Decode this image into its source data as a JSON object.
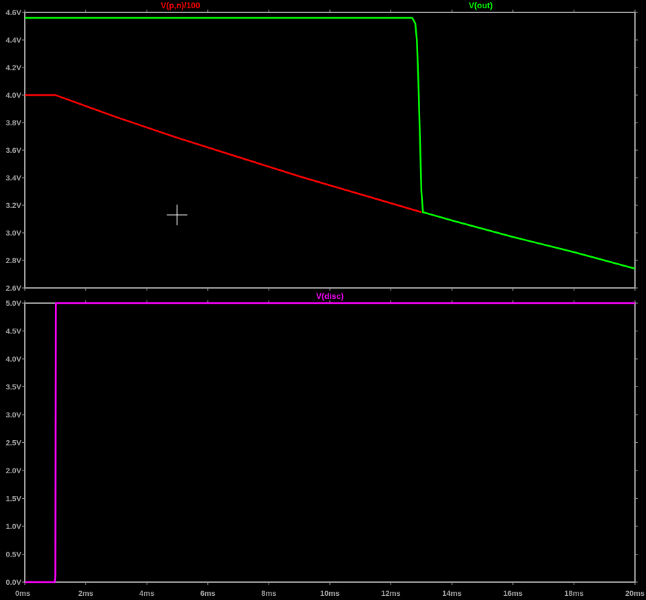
{
  "window": {
    "background": "#000000",
    "grid_color": "#a0a0a0"
  },
  "cursor": {
    "x": 4.99,
    "y": 3.13,
    "color": "#ffffff"
  },
  "chart_data": [
    {
      "type": "line",
      "pane": "top",
      "xlim": [
        0,
        20
      ],
      "ylim": [
        2.6,
        4.6
      ],
      "x_ticks": [
        0,
        2,
        4,
        6,
        8,
        10,
        12,
        14,
        16,
        18,
        20
      ],
      "y_ticks": [
        2.6,
        2.8,
        3.0,
        3.2,
        3.4,
        3.6,
        3.8,
        4.0,
        4.2,
        4.4,
        4.6
      ],
      "y_tick_labels": [
        "2.6V",
        "2.8V",
        "3.0V",
        "3.2V",
        "3.4V",
        "3.6V",
        "3.8V",
        "4.0V",
        "4.2V",
        "4.4V",
        "4.6V"
      ],
      "grid": false,
      "series": [
        {
          "name": "V(p,n)/100",
          "color": "#ff0000",
          "x": [
            0,
            1.0,
            3,
            5,
            7,
            9,
            11,
            13
          ],
          "y": [
            4.0,
            4.0,
            3.84,
            3.69,
            3.55,
            3.41,
            3.28,
            3.15
          ]
        },
        {
          "name": "V(out)",
          "color": "#00ff00",
          "x": [
            0,
            12.7,
            12.8,
            12.85,
            12.9,
            13.0,
            13.05,
            14,
            16,
            18,
            20
          ],
          "y": [
            4.56,
            4.56,
            4.52,
            4.4,
            4.1,
            3.3,
            3.15,
            3.09,
            2.97,
            2.86,
            2.74
          ]
        }
      ]
    },
    {
      "type": "line",
      "pane": "bottom",
      "xlim": [
        0,
        20
      ],
      "ylim": [
        0,
        5.0
      ],
      "x_ticks": [
        0,
        2,
        4,
        6,
        8,
        10,
        12,
        14,
        16,
        18,
        20
      ],
      "x_tick_labels": [
        "0ms",
        "2ms",
        "4ms",
        "6ms",
        "8ms",
        "10ms",
        "12ms",
        "14ms",
        "16ms",
        "18ms",
        "20ms"
      ],
      "y_ticks": [
        0,
        0.5,
        1.0,
        1.5,
        2.0,
        2.5,
        3.0,
        3.5,
        4.0,
        4.5,
        5.0
      ],
      "y_tick_labels": [
        "0.0V",
        "0.5V",
        "1.0V",
        "1.5V",
        "2.0V",
        "2.5V",
        "3.0V",
        "3.5V",
        "4.0V",
        "4.5V",
        "5.0V"
      ],
      "grid": false,
      "series": [
        {
          "name": "V(disc)",
          "color": "#ff00ff",
          "x": [
            0,
            0.98,
            1.0,
            1.02,
            20
          ],
          "y": [
            0,
            0,
            0.1,
            5.0,
            5.0
          ]
        }
      ]
    }
  ]
}
